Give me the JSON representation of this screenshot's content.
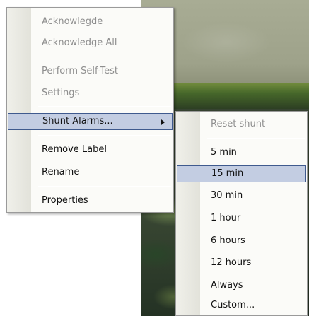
{
  "context_menu": {
    "items": [
      {
        "label": "Acknowlegde",
        "enabled": false
      },
      {
        "label": "Acknowledge All",
        "enabled": false
      },
      {
        "label": "Perform Self-Test",
        "enabled": false
      },
      {
        "label": "Settings",
        "enabled": false
      },
      {
        "label": "Shunt Alarms...",
        "enabled": true,
        "highlighted": true,
        "has_submenu": true,
        "submenu_icon": "chevron-right-icon"
      },
      {
        "label": "Remove Label",
        "enabled": true
      },
      {
        "label": "Rename",
        "enabled": true
      },
      {
        "label": "Properties",
        "enabled": true
      }
    ]
  },
  "submenu": {
    "items": [
      {
        "label": "Reset shunt",
        "enabled": false
      },
      {
        "label": "5 min",
        "enabled": true
      },
      {
        "label": "15 min",
        "enabled": true,
        "highlighted": true
      },
      {
        "label": "30 min",
        "enabled": true
      },
      {
        "label": "1 hour",
        "enabled": true
      },
      {
        "label": "6 hours",
        "enabled": true
      },
      {
        "label": "12 hours",
        "enabled": true
      },
      {
        "label": "Always",
        "enabled": true
      },
      {
        "label": "Custom...",
        "enabled": true
      }
    ]
  },
  "colors": {
    "highlight_fill": "#c3cde2",
    "highlight_border": "#3f5a8e",
    "disabled_text": "#8e8e8e",
    "menu_background": "#fbfbf8"
  }
}
